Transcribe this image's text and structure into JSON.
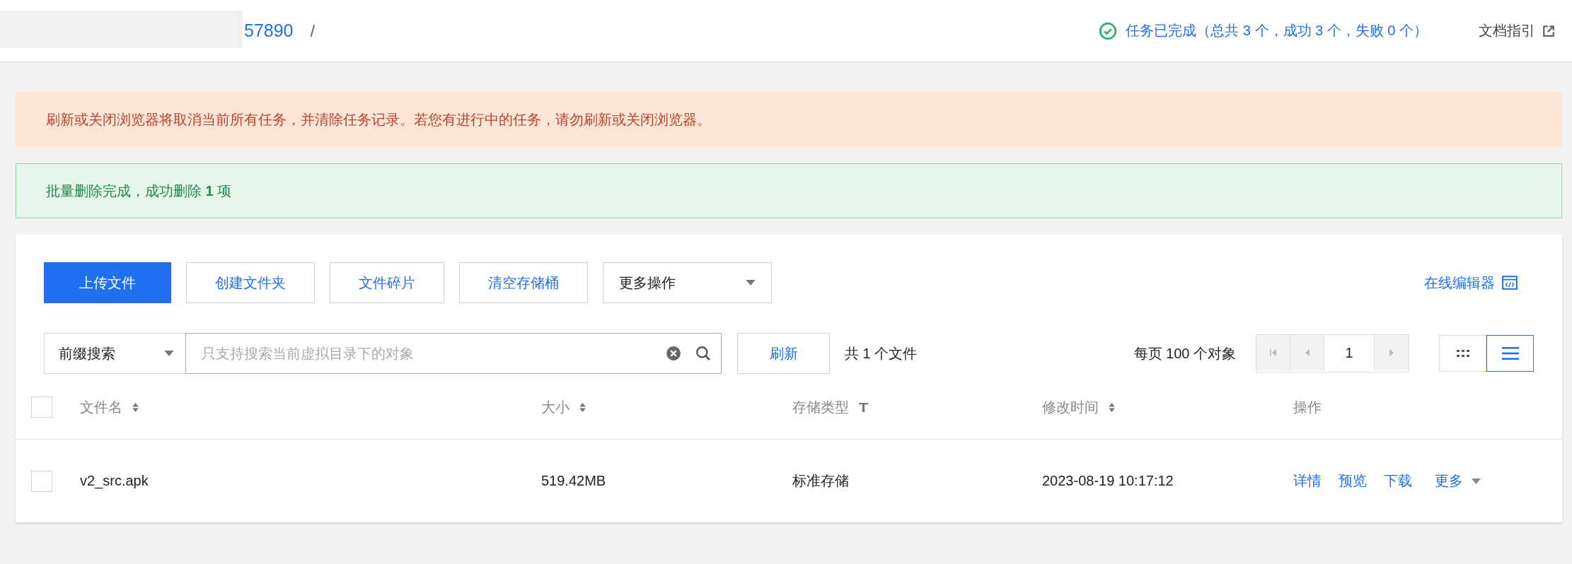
{
  "breadcrumb": {
    "bucket": "57890",
    "separator": "/"
  },
  "task_status": {
    "kind": "success",
    "text": "任务已完成（总共 3 个，成功 3 个，失败 0 个）"
  },
  "doc_link": "文档指引",
  "alerts": [
    {
      "kind": "warning",
      "text": "刷新或关闭浏览器将取消当前所有任务，并清除任务记录。若您有进行中的任务，请勿刷新或关闭浏览器。"
    },
    {
      "kind": "success",
      "text": "批量删除完成，成功删除 **1** 项"
    }
  ],
  "toolbar": {
    "buttons": [
      {
        "label": "上传文件",
        "primary": true
      },
      {
        "label": "创建文件夹",
        "primary": false
      },
      {
        "label": "文件碎片",
        "primary": false
      },
      {
        "label": "清空存储桶",
        "primary": false
      }
    ],
    "more_dropdown": "更多操作",
    "editor_link": "在线编辑器"
  },
  "search": {
    "mode": "前缀搜索",
    "placeholder": "只支持搜索当前虚拟目录下的对象",
    "refresh": "刷新",
    "count": "共 1 个文件"
  },
  "pagination": {
    "page_size": "每页 100 个对象",
    "page": "1",
    "nav": [
      {
        "kind": "first",
        "disabled": true
      },
      {
        "kind": "prev",
        "disabled": true
      },
      {
        "kind": "next",
        "disabled": true
      }
    ]
  },
  "view_modes": [
    {
      "kind": "grid",
      "selected": false
    },
    {
      "kind": "list",
      "selected": true
    }
  ],
  "table": {
    "select_all_checked": false,
    "columns": [
      {
        "label": "文件名",
        "kind": "sort"
      },
      {
        "label": "大小",
        "kind": "sort"
      },
      {
        "label": "存储类型",
        "kind": "filter"
      },
      {
        "label": "修改时间",
        "kind": "sort"
      },
      {
        "label": "操作",
        "kind": "plain"
      }
    ],
    "rows": [
      {
        "checked": false,
        "name": "v2_src.apk",
        "size": "519.42MB",
        "storage_class": "标准存储",
        "modified": "2023-08-19 10:17:12",
        "actions": [
          {
            "label": "详情",
            "kind": "link"
          },
          {
            "label": "预览",
            "kind": "link"
          },
          {
            "label": "下载",
            "kind": "link"
          },
          {
            "label": "更多",
            "kind": "menu"
          }
        ]
      }
    ]
  }
}
